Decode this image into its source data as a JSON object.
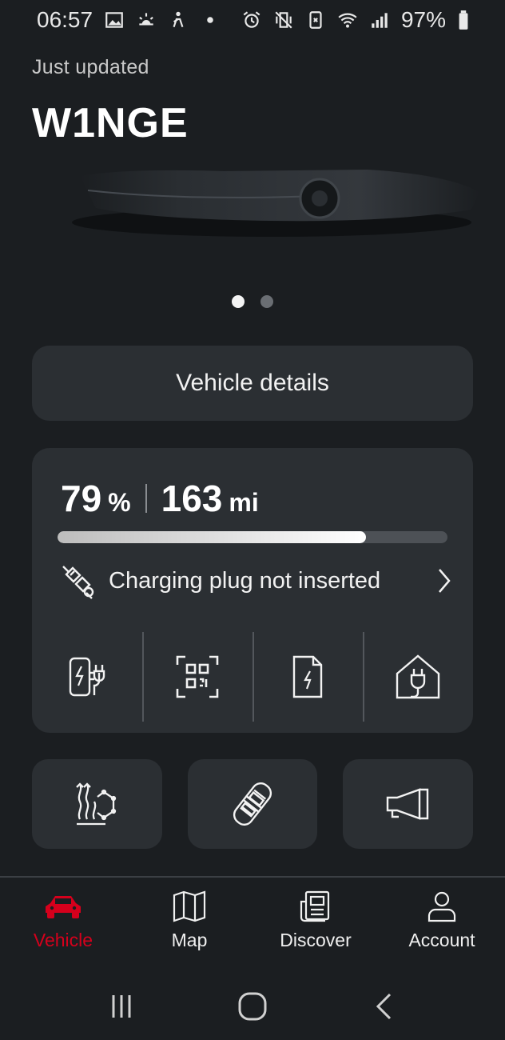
{
  "status_bar": {
    "time": "06:57",
    "battery": "97%",
    "left_icons": [
      "image-icon",
      "sunrise-icon",
      "accessibility-icon",
      "notification-dot-icon"
    ],
    "right_icons": [
      "alarm-icon",
      "vibrate-icon",
      "data-saver-icon",
      "wifi-icon",
      "signal-icon",
      "battery-icon"
    ]
  },
  "header": {
    "updated_text": "Just updated",
    "vehicle_name": "W1NGE"
  },
  "carousel": {
    "pages": 2,
    "active_index": 0
  },
  "vehicle_details_button": "Vehicle details",
  "charge": {
    "percent": "79",
    "percent_unit": "%",
    "range": "163",
    "range_unit": "mi",
    "level": 0.79,
    "plug_status": "Charging plug not inserted",
    "actions": [
      {
        "icon": "charging-station-icon",
        "name": "charging-action"
      },
      {
        "icon": "qr-code-icon",
        "name": "qr-scan-action"
      },
      {
        "icon": "charging-document-icon",
        "name": "charging-contract-action"
      },
      {
        "icon": "home-charging-icon",
        "name": "home-charging-action"
      }
    ]
  },
  "quick_actions": [
    {
      "icon": "climate-icon",
      "name": "climate-tile"
    },
    {
      "icon": "car-top-view-icon",
      "name": "vehicle-lock-tile"
    },
    {
      "icon": "horn-icon",
      "name": "horn-tile"
    }
  ],
  "bottom_nav": [
    {
      "label": "Vehicle",
      "icon": "car-icon",
      "active": true
    },
    {
      "label": "Map",
      "icon": "map-icon",
      "active": false
    },
    {
      "label": "Discover",
      "icon": "news-icon",
      "active": false
    },
    {
      "label": "Account",
      "icon": "person-icon",
      "active": false
    }
  ],
  "system_nav": [
    "recents-icon",
    "home-icon",
    "back-icon"
  ],
  "colors": {
    "background": "#1b1e21",
    "card": "#2b2f33",
    "accent_red": "#d5001c",
    "text": "#f2f2f2"
  }
}
